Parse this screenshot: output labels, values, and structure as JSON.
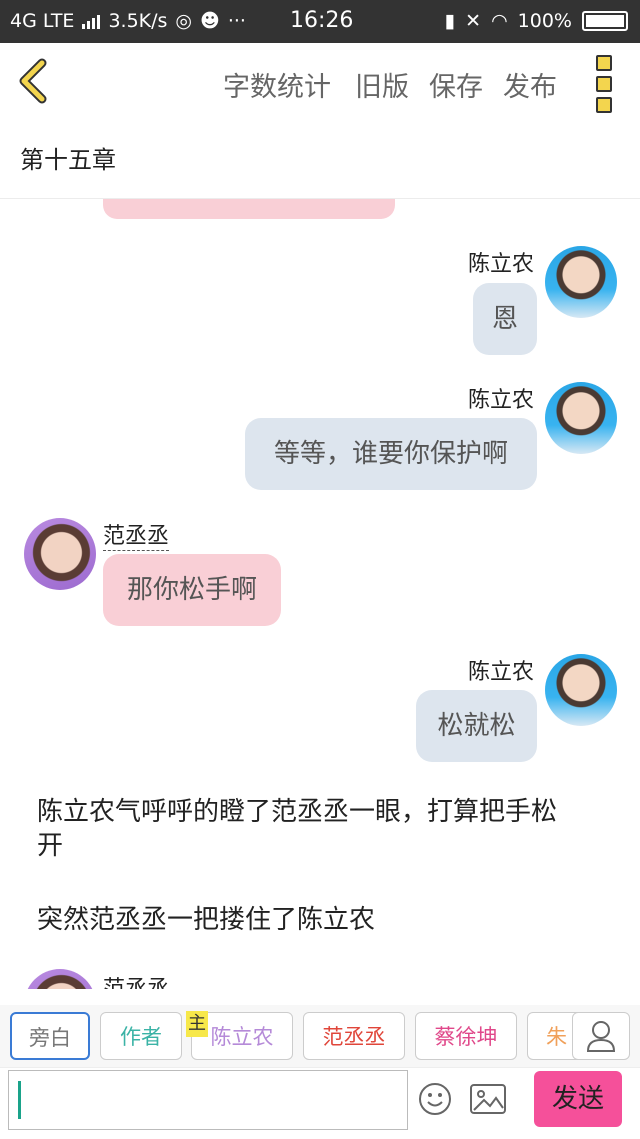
{
  "status_bar": {
    "network": "4G LTE",
    "speed": "3.5K/s",
    "more": "···",
    "time": "16:26",
    "battery": "100%"
  },
  "toolbar": {
    "word_count": "字数统计",
    "old_version": "旧版",
    "save": "保存",
    "publish": "发布"
  },
  "chapter_title": "第十五章",
  "messages": [
    {
      "side": "right",
      "speaker": "陈立农",
      "text": "恩"
    },
    {
      "side": "right",
      "speaker": "陈立农",
      "text": "等等，谁要你保护啊"
    },
    {
      "side": "left",
      "speaker": "范丞丞",
      "text": "那你松手啊"
    },
    {
      "side": "right",
      "speaker": "陈立农",
      "text": "松就松"
    }
  ],
  "narration": [
    {
      "line1": "陈立农气呼呼的瞪了范丞丞一眼，打算把手松",
      "line2": "开"
    },
    {
      "line1": "突然范丞丞一把搂住了陈立农"
    }
  ],
  "partial_speaker": "范丞丞",
  "roles": {
    "items": [
      {
        "label": "旁白",
        "color": "#777777",
        "selected": true
      },
      {
        "label": "作者",
        "color": "#3bb3a6",
        "selected": false
      },
      {
        "label": "陈立农",
        "color": "#b58ad8",
        "selected": false,
        "badge": "主"
      },
      {
        "label": "范丞丞",
        "color": "#e0463a",
        "selected": false
      },
      {
        "label": "蔡徐坤",
        "color": "#e0488a",
        "selected": false
      },
      {
        "label": "朱",
        "color": "#f0a05a",
        "selected": false
      }
    ]
  },
  "composer": {
    "placeholder": "",
    "send_label": "发送"
  },
  "colors": {
    "right_bubble": "#dde5ee",
    "left_bubble": "#f9cfd6",
    "send_button": "#f5509a",
    "accent_yellow": "#f3d54e"
  }
}
